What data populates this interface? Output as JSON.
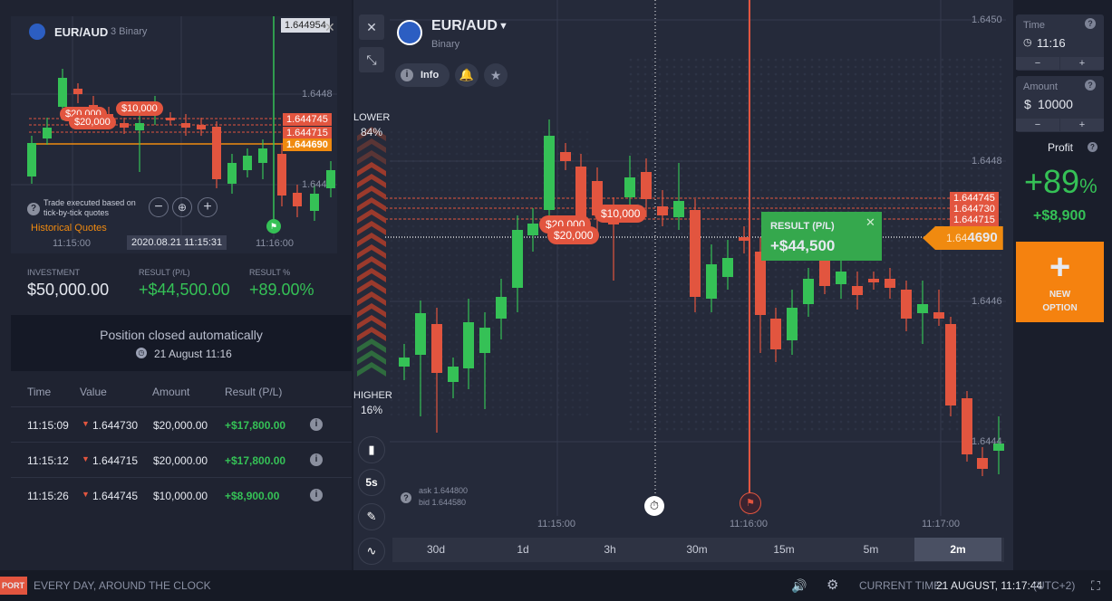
{
  "mini_chart": {
    "asset": "EUR/AUD",
    "sub": "3 Binary",
    "price_top": "1.644954",
    "price_1": "1.6448",
    "price_2": "1.644",
    "tag_745": "1.644745",
    "tag_715": "1.644715",
    "tag_690": "1.644690",
    "bubble_20k_a": "$20,000",
    "bubble_20k_b": "$20,000",
    "bubble_10k": "$10,000",
    "tick_note": "Trade executed based on tick-by-tick quotes",
    "historical": "Historical Quotes",
    "time_left": "11:15:00",
    "time_center": "2020.08.21 11:15:31",
    "time_right": "11:16:00"
  },
  "summary": {
    "investment_label": "INVESTMENT",
    "investment_value": "$50,000.00",
    "result_label": "RESULT (P/L)",
    "result_value": "+$44,500.00",
    "result_pct_label": "RESULT %",
    "result_pct_value": "+89.00%"
  },
  "closed": {
    "title": "Position closed automatically",
    "date": "21 August 11:16"
  },
  "trades": {
    "headers": [
      "Time",
      "Value",
      "Amount",
      "Result (P/L)"
    ],
    "rows": [
      {
        "time": "11:15:09",
        "value": "1.644730",
        "amount": "$20,000.00",
        "result": "+$17,800.00"
      },
      {
        "time": "11:15:12",
        "value": "1.644715",
        "amount": "$20,000.00",
        "result": "+$17,800.00"
      },
      {
        "time": "11:15:26",
        "value": "1.644745",
        "amount": "$10,000.00",
        "result": "+$8,900.00"
      }
    ]
  },
  "main": {
    "asset": "EUR/AUD",
    "type": "Binary",
    "info_label": "Info",
    "lower_label": "LOWER",
    "lower_pct": "84%",
    "higher_label": "HIGHER",
    "higher_pct": "16%",
    "price_1": "1.6450",
    "price_2": "1.6448",
    "price_3": "1.6446",
    "price_4": "1.6444",
    "tag_745": "1.644745",
    "tag_730": "1.644730",
    "tag_715": "1.644715",
    "current_price_prefix": "1.64",
    "current_price_suffix": "4690",
    "bubble_20k_a": "$20,000",
    "bubble_20k_b": "$20,000",
    "bubble_10k": "$10,000",
    "result_label": "RESULT (P/L)",
    "result_value": "+$44,500",
    "ask": "ask 1.644800",
    "bid": "bid 1.644580",
    "time_1": "11:15:00",
    "time_2": "11:16:00",
    "time_3": "11:17:00",
    "five_s": "5s",
    "periods": [
      "30d",
      "1d",
      "3h",
      "30m",
      "15m",
      "5m",
      "2m"
    ]
  },
  "right": {
    "time_label": "Time",
    "time_value": "11:16",
    "amount_label": "Amount",
    "amount_currency": "$",
    "amount_value": "10000",
    "profit_label": "Profit",
    "profit_pct": "+89",
    "profit_pct_sign": "%",
    "profit_value": "+$8,900",
    "new_option_1": "NEW",
    "new_option_2": "OPTION"
  },
  "bottom": {
    "support": "PORT",
    "slogan": "EVERY DAY, AROUND THE CLOCK",
    "current_time_label": "CURRENT TIME:",
    "current_time_value": "21 AUGUST, 11:17:44",
    "tz": "(UTC+2)"
  },
  "colors": {
    "green": "#35c156",
    "red": "#e2553f",
    "orange": "#f08a10"
  }
}
